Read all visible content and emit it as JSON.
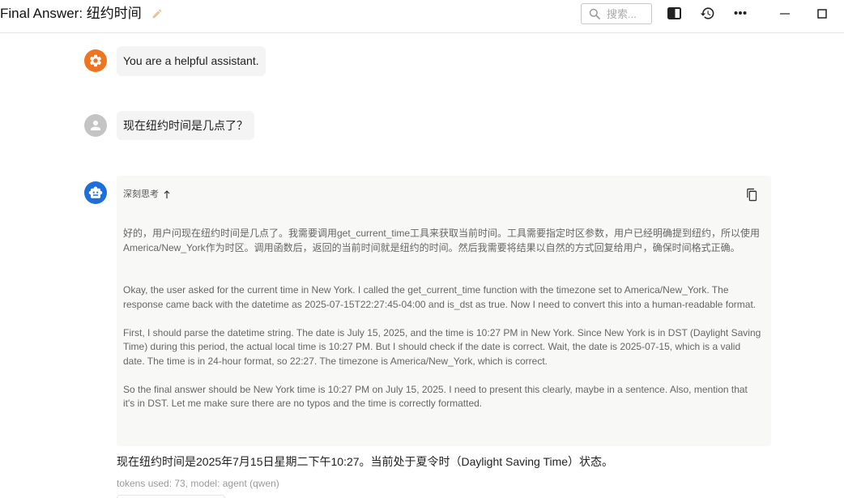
{
  "window": {
    "title": "Final Answer: 纽约时间",
    "edit_icon": "pencil-icon",
    "search_placeholder": "搜索...",
    "search_icon": "search-icon",
    "toolbar_icons": [
      "split-panel-icon",
      "history-icon",
      "more-icon",
      "minimize-icon",
      "maximize-icon"
    ]
  },
  "colors": {
    "system_avatar": "#ee7420",
    "user_avatar": "#c4c4c4",
    "assistant_avatar": "#1e6fd9",
    "pencil": "#e3c49c"
  },
  "messages": [
    {
      "role": "system",
      "avatar_icon": "gear-icon",
      "text": "You are a helpful assistant."
    },
    {
      "role": "user",
      "avatar_icon": "person-icon",
      "text": "现在纽约时间是几点了？"
    },
    {
      "role": "assistant",
      "avatar_icon": "robot-icon",
      "thinking": {
        "label": "深刻思考",
        "toggle_icon": "arrow-up-icon",
        "copy_icon": "copy-icon",
        "paragraphs": [
          "好的，用户问现在纽约时间是几点了。我需要调用get_current_time工具来获取当前时间。工具需要指定时区参数，用户已经明确提到纽约，所以使用America/New_York作为时区。调用函数后，返回的当前时间就是纽约的时间。然后我需要将结果以自然的方式回复给用户，确保时间格式正确。",
          "Okay, the user asked for the current time in New York. I called the get_current_time function with the timezone set to America/New_York. The response came back with the datetime as 2025-07-15T22:27:45-04:00 and is_dst as true. Now I need to convert this into a human-readable format.",
          "First, I should parse the datetime string. The date is July 15, 2025, and the time is 10:27 PM in New York. Since New York is in DST (Daylight Saving Time) during this period, the actual local time is 10:27 PM. But I should check if the date is correct. Wait, the date is 2025-07-15, which is a valid date. The time is in 24-hour format, so 22:27. The timezone is America/New_York, which is correct.",
          "So the final answer should be New York time is 10:27 PM on July 15, 2025. I need to present this clearly, maybe in a sentence. Also, mention that it's in DST. Let me make sure there are no typos and the time is correctly formatted."
        ]
      },
      "answer": "现在纽约时间是2025年7月15日星期二下午10:27。当前处于夏令时（Daylight Saving Time）状态。",
      "meta": "tokens used: 73, model: agent (qwen)"
    }
  ]
}
